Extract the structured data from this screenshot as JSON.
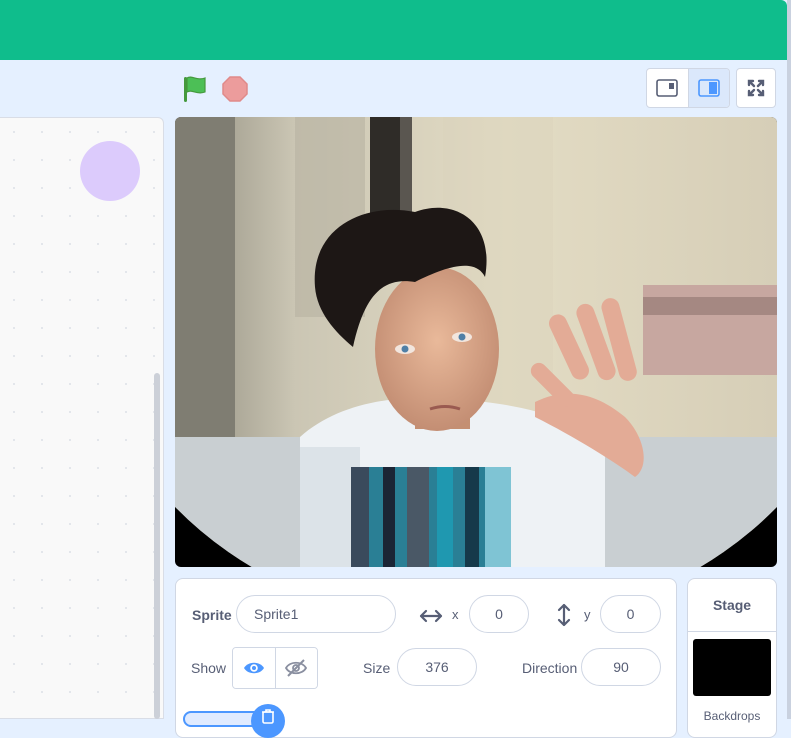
{
  "controls": {
    "flag_icon": "green-flag-icon",
    "stop_icon": "stop-icon"
  },
  "sprite": {
    "label": "Sprite",
    "name": "Sprite1",
    "x_label": "x",
    "x": "0",
    "y_label": "y",
    "y": "0",
    "show_label": "Show",
    "size_label": "Size",
    "size": "376",
    "direction_label": "Direction",
    "direction": "90"
  },
  "stage_panel": {
    "title": "Stage",
    "backdrops_label": "Backdrops"
  },
  "colors": {
    "menu_bar": "#0fbd8c",
    "accent": "#4c97ff",
    "stop": "#ec9c9c",
    "flag": "#4cbf56"
  }
}
